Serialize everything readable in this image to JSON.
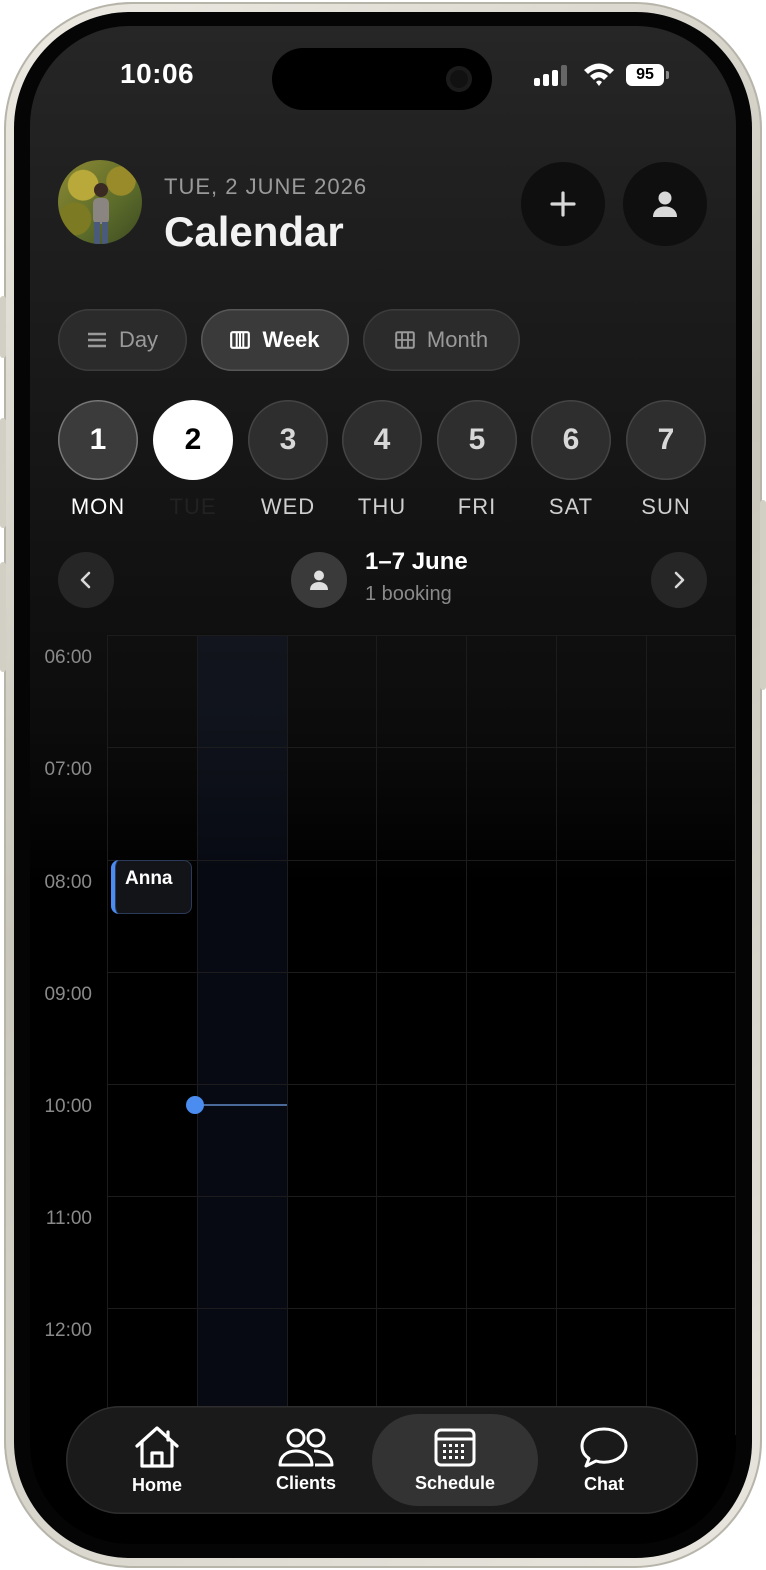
{
  "status_bar": {
    "time": "10:06",
    "battery": "95"
  },
  "header": {
    "date": "TUE, 2 JUNE 2026",
    "title": "Calendar"
  },
  "view_switcher": {
    "options": [
      {
        "label": "Day",
        "icon": "list-icon",
        "active": false
      },
      {
        "label": "Week",
        "icon": "week-columns-icon",
        "active": true
      },
      {
        "label": "Month",
        "icon": "grid-icon",
        "active": false
      }
    ]
  },
  "week_days": [
    {
      "num": "1",
      "name": "MON"
    },
    {
      "num": "2",
      "name": "TUE",
      "selected": true
    },
    {
      "num": "3",
      "name": "WED"
    },
    {
      "num": "4",
      "name": "THU"
    },
    {
      "num": "5",
      "name": "FRI"
    },
    {
      "num": "6",
      "name": "SAT"
    },
    {
      "num": "7",
      "name": "SUN"
    }
  ],
  "range": {
    "title": "1–7 June",
    "subtitle": "1 booking"
  },
  "timeline": {
    "hours": [
      "06:00",
      "07:00",
      "08:00",
      "09:00",
      "10:00",
      "11:00",
      "12:00"
    ],
    "bookings": [
      {
        "name": "Anna",
        "day": "MON",
        "start": "08:00"
      }
    ],
    "now": "10:06",
    "accent": "#4a8cf0"
  },
  "tabs": [
    {
      "label": "Home",
      "icon": "home-icon"
    },
    {
      "label": "Clients",
      "icon": "clients-icon"
    },
    {
      "label": "Schedule",
      "icon": "calendar-icon",
      "active": true
    },
    {
      "label": "Chat",
      "icon": "chat-icon"
    }
  ]
}
